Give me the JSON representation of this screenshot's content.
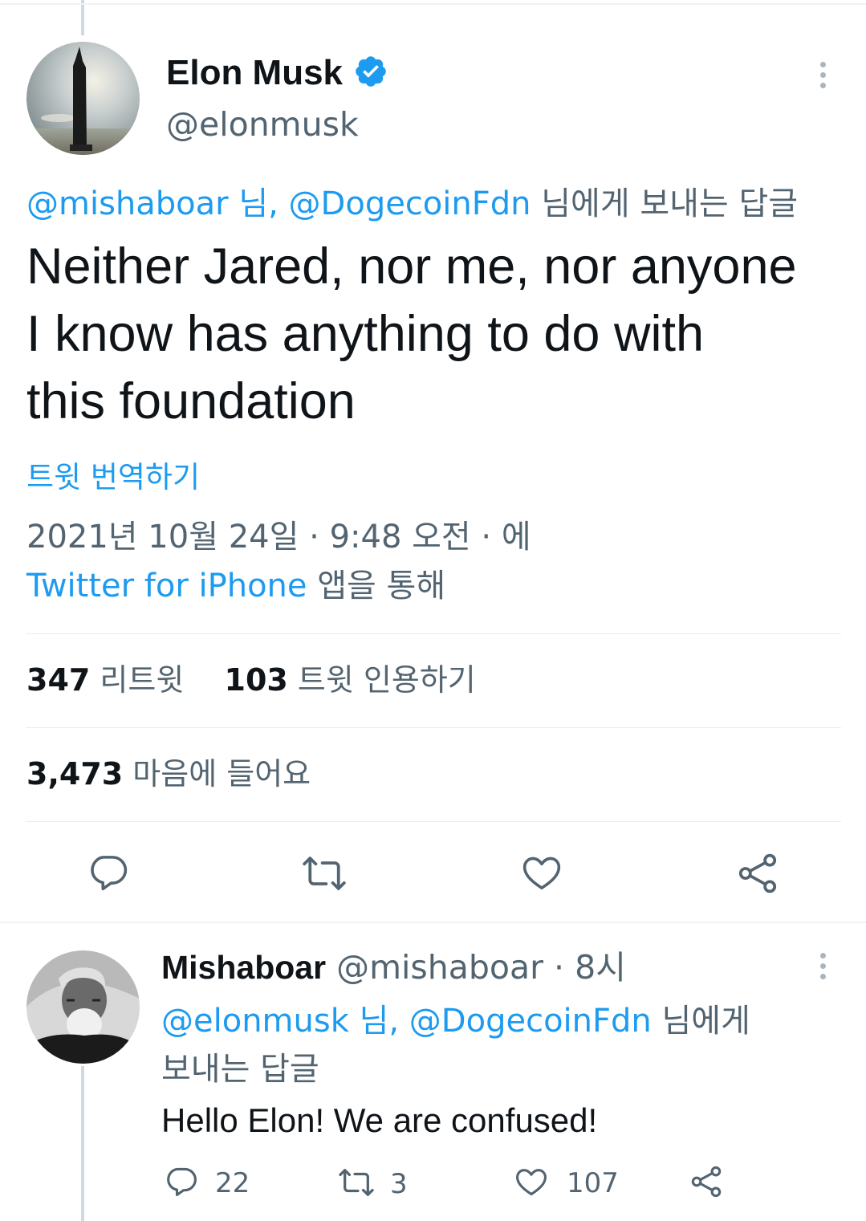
{
  "tweet": {
    "author_name": "Elon Musk",
    "author_handle": "@elonmusk",
    "reply_context_mentions": "@mishaboar 님, @DogecoinFdn",
    "reply_context_suffix": "님에게 보내는 답글",
    "text_line1": "Neither Jared, nor me, nor anyone",
    "text_line2": "I know has anything to do with",
    "text_line3": "this foundation",
    "translate_label": "트윗 번역하기",
    "timestamp": "2021년 10월 24일 · 9:48 오전 · 에",
    "source_app": "Twitter for iPhone",
    "source_suffix": "앱을 통해",
    "retweets_count": "347",
    "retweets_label": "리트윗",
    "quotes_count": "103",
    "quotes_label": "트윗 인용하기",
    "likes_count": "3,473",
    "likes_label": "마음에 들어요"
  },
  "reply": {
    "author_name": "Mishaboar",
    "author_handle": "@mishaboar",
    "time": "· 8시",
    "reply_context_mentions": "@elonmusk 님, @DogecoinFdn",
    "reply_context_suffix_line1": "님에게",
    "reply_context_suffix_line2": "보내는 답글",
    "text": "Hello Elon! We are confused!",
    "reply_count": "22",
    "retweet_count": "3",
    "like_count": "107"
  },
  "icons": [
    "verified-badge-icon",
    "more-icon",
    "reply-icon",
    "retweet-icon",
    "like-icon",
    "share-icon"
  ],
  "colors": {
    "accent": "#1d9bf0",
    "muted": "#536471",
    "text": "#0f1419"
  }
}
